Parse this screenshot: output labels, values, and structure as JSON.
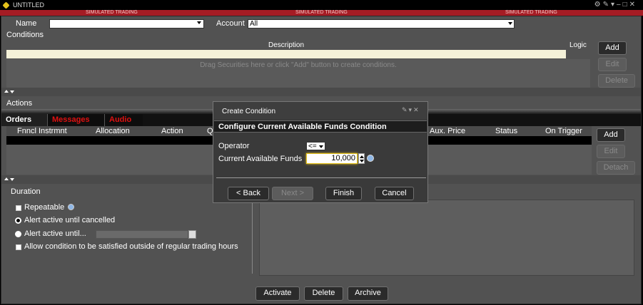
{
  "window": {
    "title": "UNTITLED",
    "sim_label": "SIMULATED TRADING",
    "controls": [
      "gear-icon",
      "pin-icon",
      "dropdown-icon",
      "minimize-icon",
      "maximize-icon",
      "close-icon"
    ]
  },
  "top": {
    "name_label": "Name",
    "name_value": "",
    "account_label": "Account",
    "account_value": "All"
  },
  "conditions": {
    "header": "Conditions",
    "col_description": "Description",
    "col_logic": "Logic",
    "drop_hint": "Drag Securities here or click \"Add\" button to create conditions.",
    "add": "Add",
    "edit": "Edit",
    "delete": "Delete"
  },
  "actions": {
    "header": "Actions",
    "tabs": [
      "Orders",
      "Messages",
      "Audio"
    ],
    "columns": [
      "Fnncl Instrmnt",
      "Allocation",
      "Action",
      "Q",
      "Aux. Price",
      "Status",
      "On Trigger"
    ],
    "add": "Add",
    "edit": "Edit",
    "detach": "Detach"
  },
  "duration": {
    "header": "Duration",
    "repeatable": "Repeatable",
    "until_cancelled": "Alert active until cancelled",
    "until_date": "Alert active until...",
    "outside_rth": "Allow condition to be satisfied outside of regular trading hours"
  },
  "bottom_buttons": {
    "activate": "Activate",
    "delete": "Delete",
    "archive": "Archive"
  },
  "dialog": {
    "title": "Create Condition",
    "heading": "Configure Current Available Funds Condition",
    "operator_label": "Operator",
    "operator_value": "<=",
    "funds_label": "Current Available Funds",
    "funds_value": "10,000",
    "back": "< Back",
    "next": "Next >",
    "finish": "Finish",
    "cancel": "Cancel"
  },
  "colors": {
    "sim_bar": "#a51c24",
    "panel": "#525252",
    "tab_active": "#1f1f1f",
    "tab_inactive_text": "#e01010",
    "description_bg": "#f4f1d8"
  }
}
